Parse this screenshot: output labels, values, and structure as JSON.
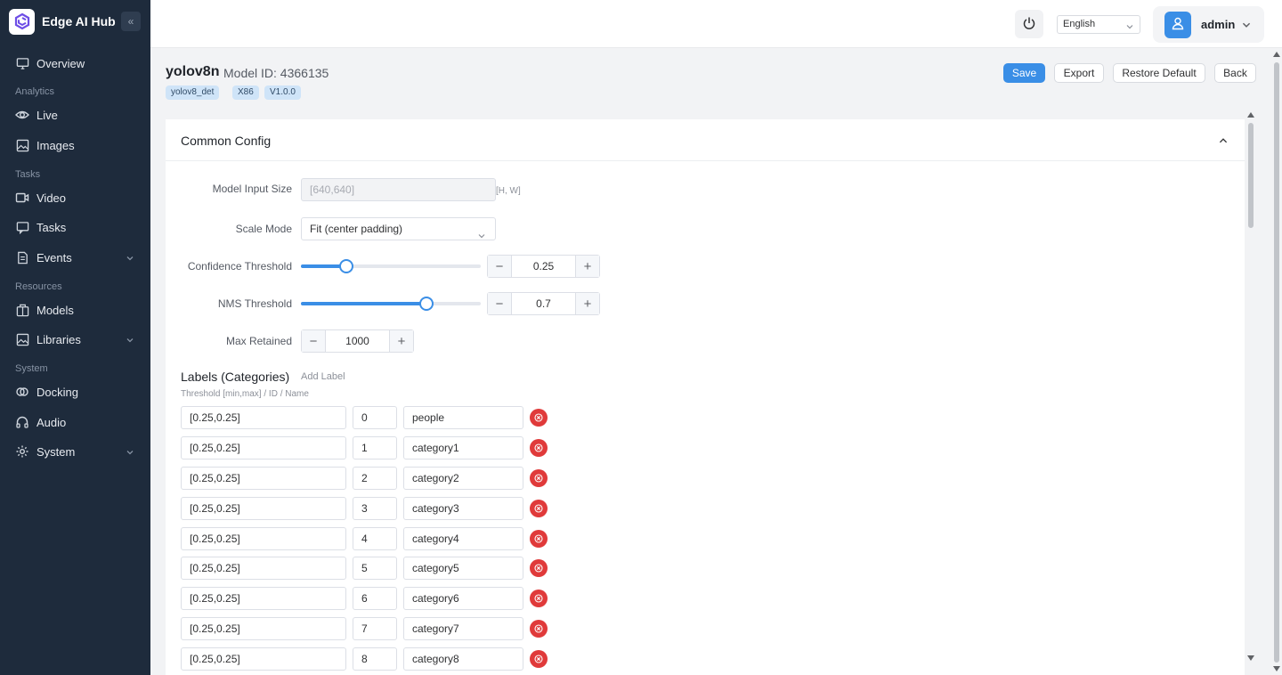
{
  "app": {
    "name": "Edge AI Hub"
  },
  "sidebar": {
    "items": [
      {
        "label": "Overview",
        "icon": "monitor-icon"
      },
      {
        "label": "Live",
        "icon": "eye-icon"
      },
      {
        "label": "Images",
        "icon": "image-icon"
      },
      {
        "label": "Video",
        "icon": "video-icon"
      },
      {
        "label": "Tasks",
        "icon": "chat-icon"
      },
      {
        "label": "Events",
        "icon": "document-icon"
      },
      {
        "label": "Models",
        "icon": "package-icon"
      },
      {
        "label": "Libraries",
        "icon": "image-library-icon"
      },
      {
        "label": "Docking",
        "icon": "link-icon"
      },
      {
        "label": "Audio",
        "icon": "headphones-icon"
      },
      {
        "label": "System",
        "icon": "gear-icon"
      }
    ],
    "sections": {
      "analytics": "Analytics",
      "tasks": "Tasks",
      "resources": "Resources",
      "system": "System"
    }
  },
  "header": {
    "language": "English",
    "user": "admin"
  },
  "model": {
    "name": "yolov8n",
    "id_text": "Model ID: 4366135",
    "tags": [
      "yolov8_det",
      "X86",
      "V1.0.0"
    ]
  },
  "actions": {
    "save": "Save",
    "export": "Export",
    "restore": "Restore Default",
    "back": "Back"
  },
  "config": {
    "title": "Common Config",
    "input_size_label": "Model Input Size",
    "input_size_value": "[640,640]",
    "input_size_hint": "[H, W]",
    "scale_mode_label": "Scale Mode",
    "scale_mode_value": "Fit (center padding)",
    "confidence_label": "Confidence Threshold",
    "confidence_value": "0.25",
    "confidence_fraction": 0.25,
    "nms_label": "NMS Threshold",
    "nms_value": "0.7",
    "nms_fraction": 0.7,
    "max_retained_label": "Max Retained",
    "max_retained_value": "1000"
  },
  "labels": {
    "title": "Labels (Categories)",
    "add": "Add Label",
    "subtitle": "Threshold [min,max] / ID / Name",
    "rows": [
      {
        "threshold": "[0.25,0.25]",
        "id": "0",
        "name": "people"
      },
      {
        "threshold": "[0.25,0.25]",
        "id": "1",
        "name": "category1"
      },
      {
        "threshold": "[0.25,0.25]",
        "id": "2",
        "name": "category2"
      },
      {
        "threshold": "[0.25,0.25]",
        "id": "3",
        "name": "category3"
      },
      {
        "threshold": "[0.25,0.25]",
        "id": "4",
        "name": "category4"
      },
      {
        "threshold": "[0.25,0.25]",
        "id": "5",
        "name": "category5"
      },
      {
        "threshold": "[0.25,0.25]",
        "id": "6",
        "name": "category6"
      },
      {
        "threshold": "[0.25,0.25]",
        "id": "7",
        "name": "category7"
      },
      {
        "threshold": "[0.25,0.25]",
        "id": "8",
        "name": "category8"
      }
    ]
  },
  "colors": {
    "accent": "#3a8ee6",
    "sidebar": "#1e2b3c",
    "danger": "#e03a3a"
  }
}
